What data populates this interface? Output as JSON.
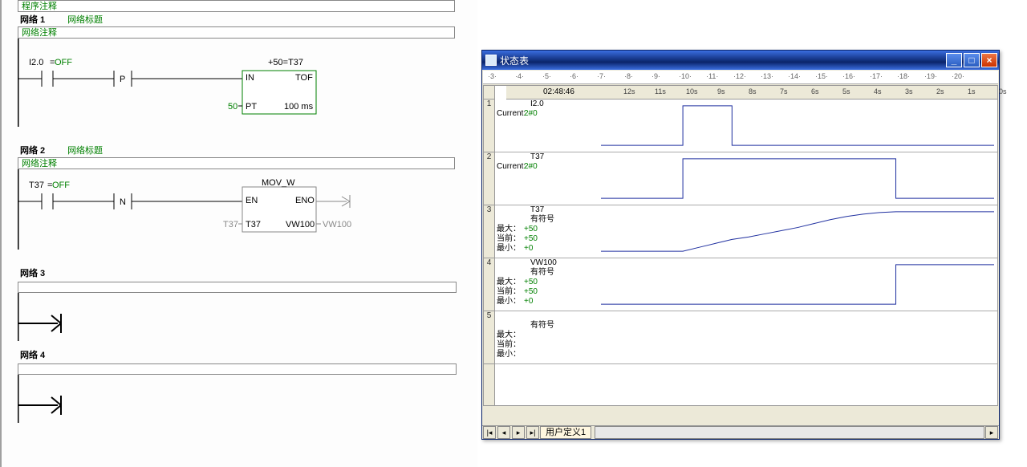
{
  "program": {
    "comment_header": "程序注释",
    "networks": [
      {
        "num": "网络 1",
        "title": "网络标题",
        "comment": "网络注释",
        "contact": {
          "name": "I2.0",
          "state": "OFF"
        },
        "edge": "P",
        "result_top": "+50=T37",
        "box": {
          "type": "TOF",
          "in": "IN",
          "pt_label": "PT",
          "pt_val": "50",
          "pt_unit": "100 ms"
        }
      },
      {
        "num": "网络 2",
        "title": "网络标题",
        "comment": "网络注释",
        "contact": {
          "name": "T37",
          "state": "OFF"
        },
        "edge": "N",
        "box": {
          "type": "MOV_W",
          "en": "EN",
          "eno": "ENO",
          "in_lbl": "T37",
          "in_val": "T37",
          "out_lbl": "VW100",
          "out_val": "VW100"
        }
      },
      {
        "num": "网络 3"
      },
      {
        "num": "网络 4"
      }
    ]
  },
  "status_window": {
    "title": "状态表",
    "ruler_marks": [
      "·3·",
      "·4·",
      "·5·",
      "·6·",
      "·7·",
      "·8·",
      "·9·",
      "·10·",
      "·11·",
      "·12·",
      "·13·",
      "·14·",
      "·15·",
      "·16·",
      "·17·",
      "·18·",
      "·19·",
      "·20·"
    ],
    "time_display": "02:48:46",
    "time_axis": [
      "12s",
      "11s",
      "10s",
      "9s",
      "8s",
      "7s",
      "6s",
      "5s",
      "4s",
      "3s",
      "2s",
      "1s",
      "0s"
    ],
    "tab": "用户定义1",
    "rows": [
      {
        "idx": "1",
        "signal": "I2.0",
        "current_label": "Current:",
        "current": "2#0"
      },
      {
        "idx": "2",
        "signal": "T37",
        "current_label": "Current:",
        "current": "2#0"
      },
      {
        "idx": "3",
        "signal": "T37",
        "format": "有符号",
        "max_label": "最大：",
        "max": "+50",
        "cur_label": "当前：",
        "cur": "+50",
        "min_label": "最小：",
        "min": "+0"
      },
      {
        "idx": "4",
        "signal": "VW100",
        "format": "有符号",
        "max_label": "最大：",
        "max": "+50",
        "cur_label": "当前：",
        "cur": "+50",
        "min_label": "最小：",
        "min": "+0"
      },
      {
        "idx": "5",
        "signal": "",
        "format": "有符号",
        "max_label": "最大：",
        "max": "",
        "cur_label": "当前：",
        "cur": "",
        "min_label": "最小：",
        "min": ""
      }
    ]
  },
  "chart_data": [
    {
      "type": "line",
      "name": "I2.0",
      "x_seconds": [
        12,
        9.5,
        9.5,
        8,
        8,
        0
      ],
      "y": [
        0,
        0,
        1,
        1,
        0,
        0
      ],
      "ylim": [
        0,
        1
      ]
    },
    {
      "type": "line",
      "name": "T37 (bit)",
      "x_seconds": [
        12,
        9.5,
        9.5,
        3,
        3,
        0
      ],
      "y": [
        0,
        0,
        1,
        1,
        0,
        0
      ],
      "ylim": [
        0,
        1
      ]
    },
    {
      "type": "line",
      "name": "T37 (value)",
      "x_seconds": [
        12,
        9.5,
        9,
        8.5,
        8,
        7.5,
        7,
        6.5,
        6,
        5.5,
        5,
        4.5,
        4,
        3.5,
        3,
        0
      ],
      "y": [
        0,
        0,
        5,
        10,
        15,
        18,
        22,
        26,
        30,
        35,
        40,
        44,
        47,
        49,
        50,
        50
      ],
      "ylim": [
        0,
        50
      ]
    },
    {
      "type": "line",
      "name": "VW100",
      "x_seconds": [
        12,
        3,
        3,
        0
      ],
      "y": [
        0,
        0,
        50,
        50
      ],
      "ylim": [
        0,
        50
      ]
    }
  ]
}
